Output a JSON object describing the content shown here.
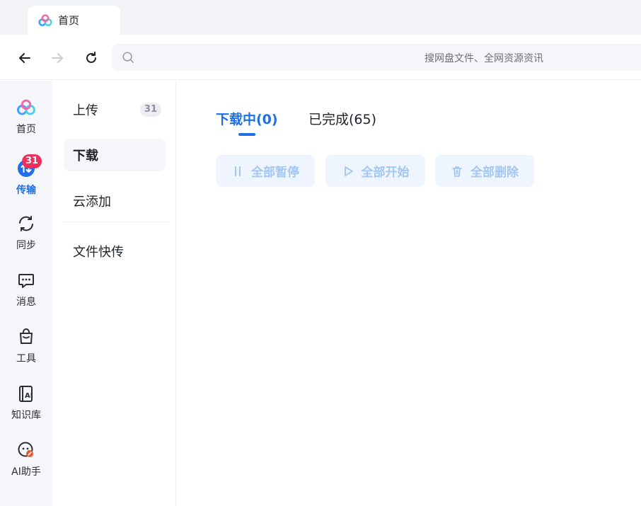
{
  "window": {
    "tab_title": "首页",
    "tab_icon": "cloud-logo-icon"
  },
  "toolbar": {
    "back_icon": "arrow-left-icon",
    "forward_icon": "arrow-right-icon",
    "refresh_icon": "refresh-icon",
    "search_icon": "search-icon",
    "search_placeholder": "搜网盘文件、全网资源资讯",
    "search_value": ""
  },
  "sidebar": {
    "items": [
      {
        "label": "首页",
        "icon": "cloud-logo-icon"
      },
      {
        "label": "传输",
        "icon": "transfer-icon",
        "badge": "31"
      },
      {
        "label": "同步",
        "icon": "sync-icon"
      },
      {
        "label": "消息",
        "icon": "message-icon"
      },
      {
        "label": "工具",
        "icon": "toolbox-icon"
      },
      {
        "label": "知识库",
        "icon": "knowledge-ai-icon"
      },
      {
        "label": "AI助手",
        "icon": "ai-assistant-icon"
      }
    ]
  },
  "subnav": {
    "items": [
      {
        "label": "上传",
        "count": "31"
      },
      {
        "label": "下载"
      },
      {
        "label": "云添加"
      },
      {
        "label": "文件快传"
      }
    ]
  },
  "main": {
    "tabs": [
      {
        "label": "下载中(0)"
      },
      {
        "label": "已完成(65)"
      }
    ],
    "actions": [
      {
        "label": "全部暂停",
        "icon": "pause-icon"
      },
      {
        "label": "全部开始",
        "icon": "play-icon"
      },
      {
        "label": "全部删除",
        "icon": "trash-icon"
      }
    ]
  },
  "colors": {
    "accent": "#1f6fe8",
    "badge": "#ef2e5c",
    "disabled_button_bg": "#eef5fe",
    "disabled_button_text": "#a3c7f3"
  }
}
